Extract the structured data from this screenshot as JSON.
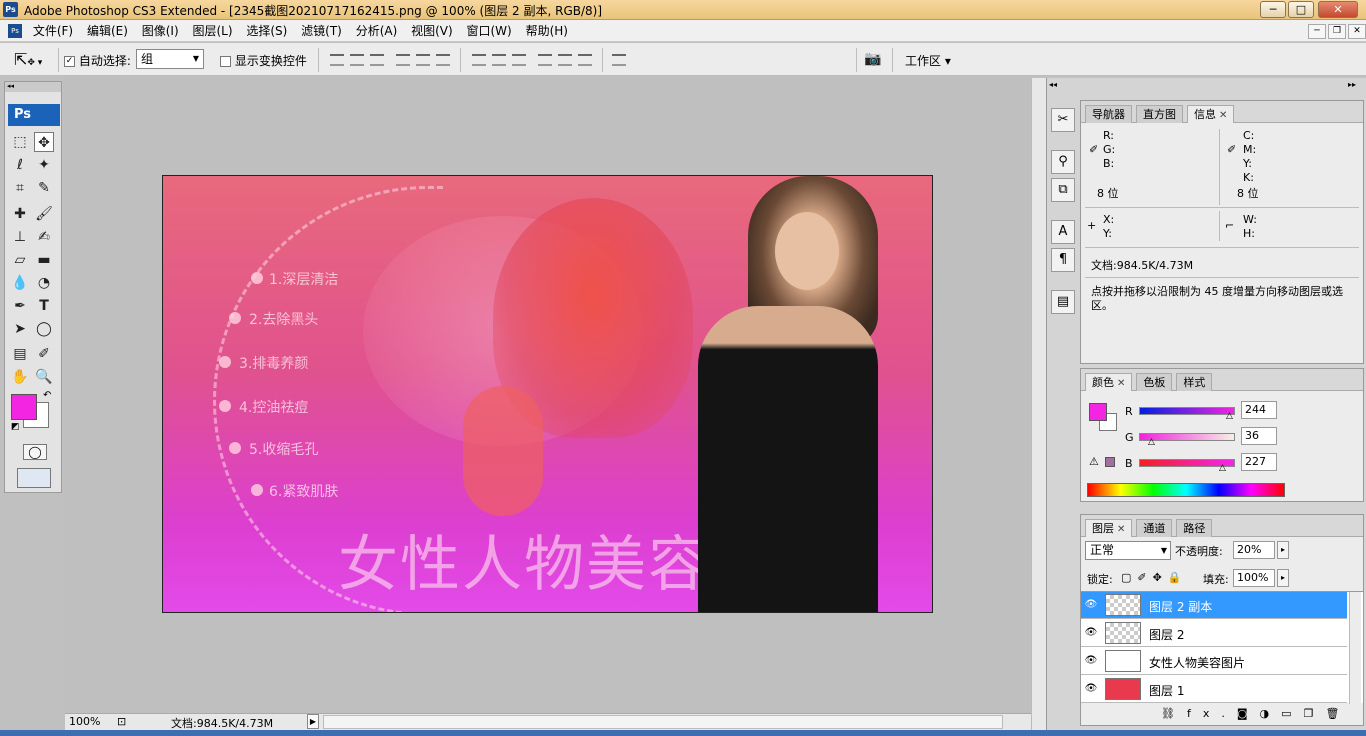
{
  "titlebar": {
    "app_badge": "Ps",
    "title": "Adobe Photoshop CS3 Extended - [2345截图20210717162415.png @ 100% (图层 2 副本, RGB/8)]",
    "minimize": "─",
    "maximize": "□",
    "close": "✕"
  },
  "menubar": {
    "items": [
      "文件(F)",
      "编辑(E)",
      "图像(I)",
      "图层(L)",
      "选择(S)",
      "滤镜(T)",
      "分析(A)",
      "视图(V)",
      "窗口(W)",
      "帮助(H)"
    ],
    "doc_minimize": "─",
    "doc_restore": "❐",
    "doc_close": "✕"
  },
  "options": {
    "auto_select_label": "自动选择:",
    "auto_select_checked": "✓",
    "auto_select_value": "组",
    "show_transform_label": "显示变换控件",
    "workspace_label": "工作区 ▾"
  },
  "toolbox": {
    "badge": "Ps",
    "foreground_color": "#f424e3",
    "background_color": "#ffffff"
  },
  "canvas": {
    "headline": "女性人物美容图片",
    "list": [
      "1.深层清洁",
      "2.去除黑头",
      "3.排毒养颜",
      "4.控油祛痘",
      "5.收缩毛孔",
      "6.紧致肌肤"
    ]
  },
  "statusbar": {
    "zoom": "100%",
    "doc_info": "文档:984.5K/4.73M"
  },
  "info_panel": {
    "tabs": [
      "导航器",
      "直方图",
      "信息"
    ],
    "rgb_labels": [
      "R:",
      "G:",
      "B:"
    ],
    "cmyk_labels": [
      "C:",
      "M:",
      "Y:",
      "K:"
    ],
    "bit_left": "8 位",
    "bit_right": "8 位",
    "x_label": "X:",
    "y_label": "Y:",
    "w_label": "W:",
    "h_label": "H:",
    "doc_info": "文档:984.5K/4.73M",
    "hint": "点按并拖移以沿限制为 45 度增量方向移动图层或选区。"
  },
  "color_panel": {
    "tabs": [
      "颜色",
      "色板",
      "样式"
    ],
    "r_label": "R",
    "g_label": "G",
    "b_label": "B",
    "r_value": "244",
    "g_value": "36",
    "b_value": "227",
    "fg": "#f424e3"
  },
  "layers_panel": {
    "tabs": [
      "图层",
      "通道",
      "路径"
    ],
    "blend_mode": "正常",
    "opacity_label": "不透明度:",
    "opacity_value": "20%",
    "lock_label": "锁定:",
    "fill_label": "填充:",
    "fill_value": "100%",
    "layers": [
      {
        "name": "图层 2 副本",
        "selected": true
      },
      {
        "name": "图层 2",
        "selected": false
      },
      {
        "name": "女性人物美容图片",
        "selected": false
      },
      {
        "name": "图层 1",
        "selected": false
      }
    ],
    "footer_icons": [
      "link-icon",
      "fx-icon",
      "mask-icon",
      "adjustment-icon",
      "group-icon",
      "new-layer-icon",
      "trash-icon"
    ],
    "footer_fx": "fx."
  }
}
